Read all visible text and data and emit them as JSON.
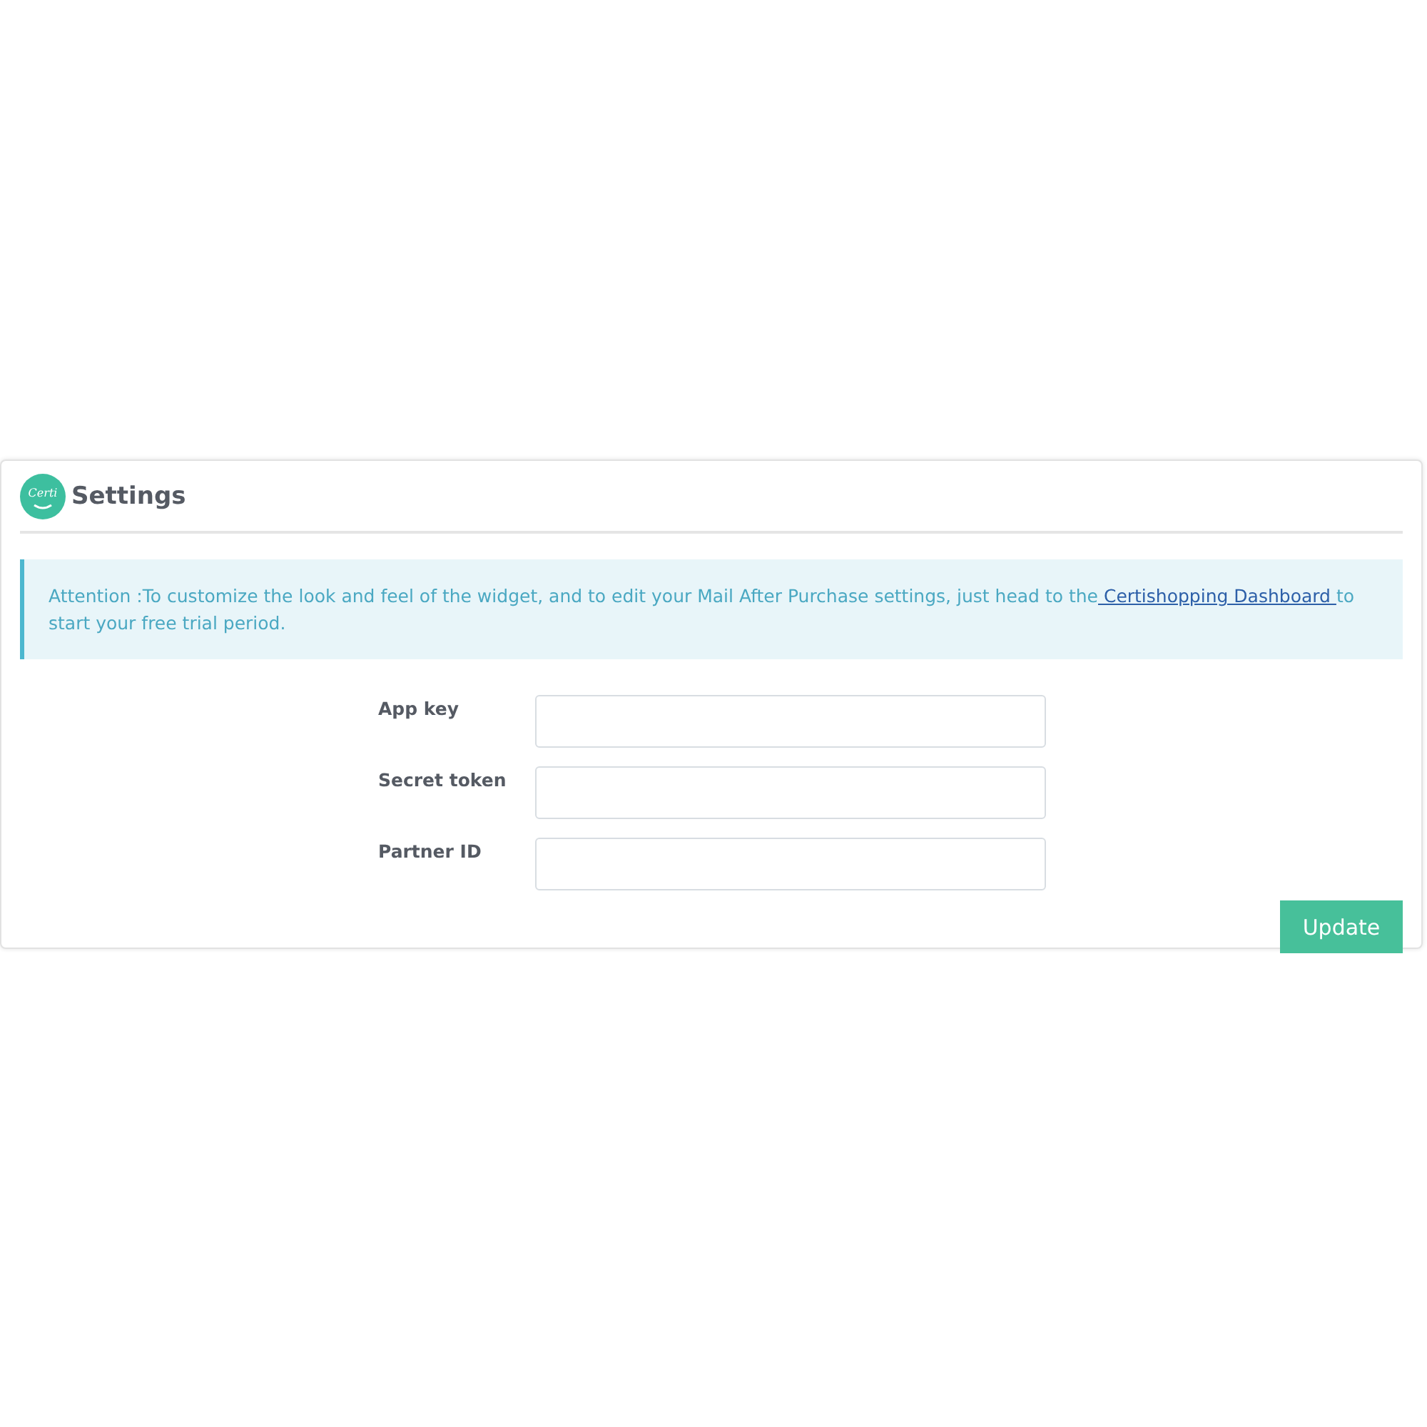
{
  "panel": {
    "logo_text": "Certi",
    "title": "Settings"
  },
  "alert": {
    "text": "Attention :To customize the look and feel of the widget, and to edit your Mail After Purchase settings, just head to the",
    "link": " Certishopping Dashboard ",
    "text_after": "to start your free trial period."
  },
  "fields": [
    {
      "label": "App key"
    },
    {
      "label": "Secret token"
    },
    {
      "label": "Partner ID"
    }
  ],
  "buttons": [
    "Update"
  ]
}
